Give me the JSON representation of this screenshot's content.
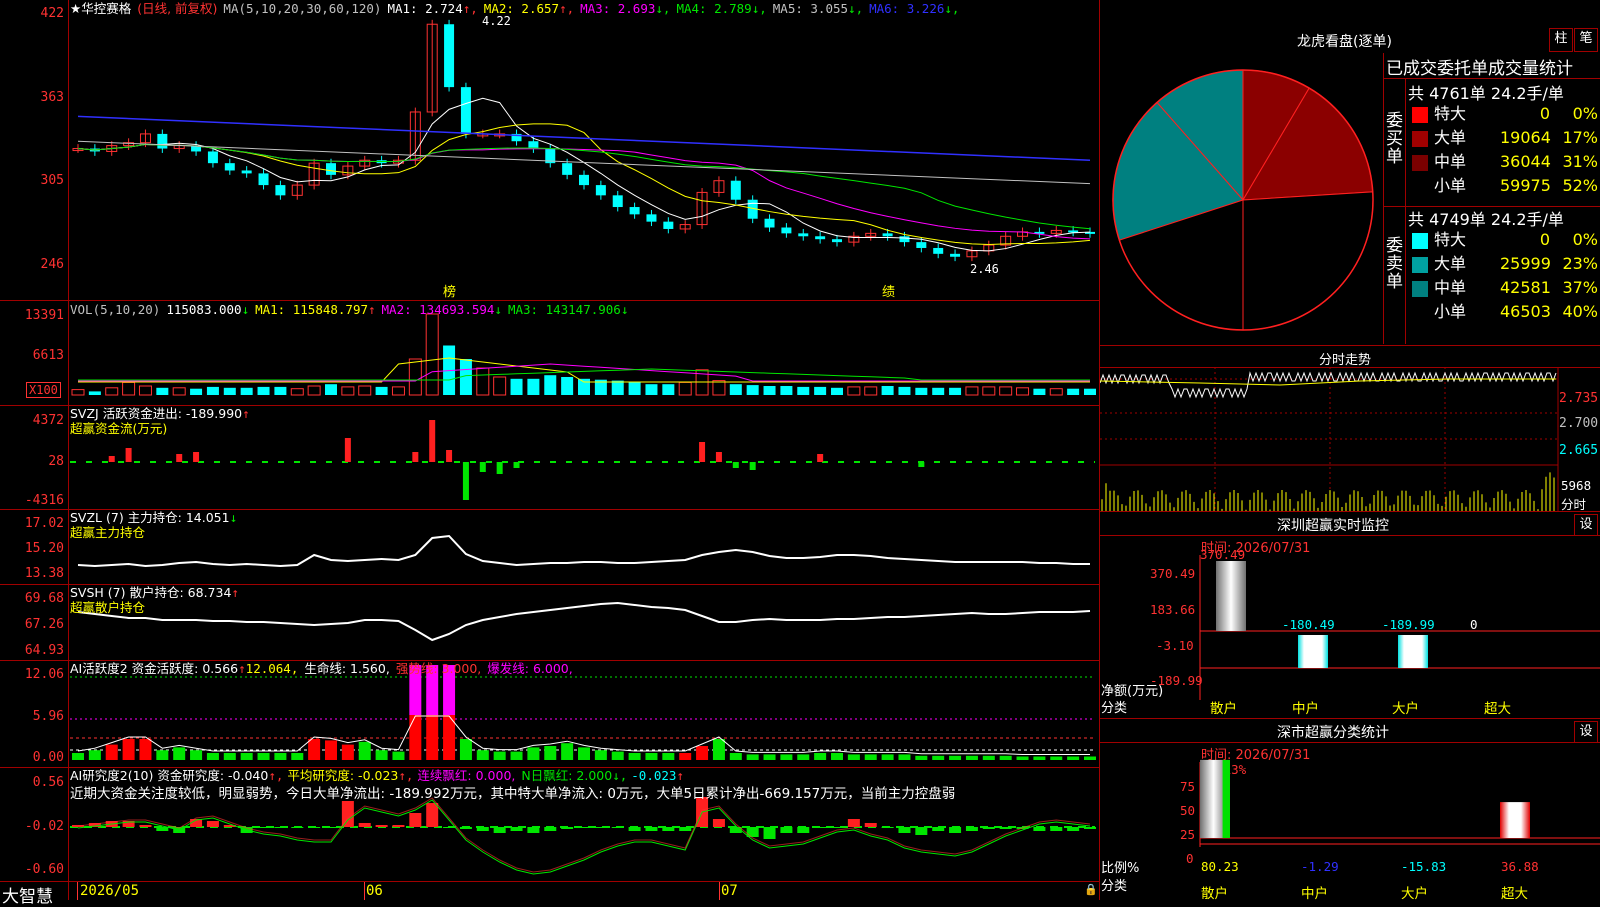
{
  "stock": {
    "name_star": "★华控赛格",
    "period": "(日线, 前复权)",
    "ma_title": "MA(5,10,20,30,60,120)",
    "ma_values": [
      {
        "label": "MA1: 2.724",
        "arrow": "↑",
        "color": "#ffffff"
      },
      {
        "label": "MA2: 2.657",
        "arrow": "↑",
        "color": "#ffff00"
      },
      {
        "label": "MA3: 2.693",
        "arrow": "↓",
        "color": "#ff00ff"
      },
      {
        "label": "MA4: 2.789",
        "arrow": "↓",
        "color": "#00e600"
      },
      {
        "label": "MA5: 3.055",
        "arrow": "↓",
        "color": "#c0c0c0"
      },
      {
        "label": "MA6: 3.226",
        "arrow": "↓",
        "color": "#3030ff"
      }
    ],
    "price_axis": [
      "422",
      "363",
      "305",
      "246"
    ],
    "high_label": "4.22",
    "low_label": "2.46",
    "mark_bang": "榜",
    "mark_ji": "绩"
  },
  "vol": {
    "title": "VOL(5,10,20)",
    "value": "115083.000",
    "arrow": "↓",
    "ma1": "MA1: 115848.797",
    "ma1_arrow": "↑",
    "ma2": "MA2: 134693.594",
    "ma2_arrow": "↓",
    "ma3": "MA3: 143147.906",
    "ma3_arrow": "↓",
    "axis": [
      "13391",
      "6613"
    ],
    "unit": "X100"
  },
  "svzj": {
    "title": "SVZJ  活跃资金进出: -189.990",
    "arrow": "↑",
    "sub": "超赢资金流(万元)",
    "axis": [
      "4372",
      "28",
      "-4316"
    ]
  },
  "svzl": {
    "title": "SVZL (7) 主力持仓: 14.051",
    "arrow": "↓",
    "sub": "超赢主力持仓",
    "axis": [
      "17.02",
      "15.20",
      "13.38"
    ]
  },
  "svsh": {
    "title": "SVSH (7) 散户持仓: 68.734",
    "arrow": "↑",
    "sub": "超赢散户持仓",
    "axis": [
      "69.68",
      "67.26",
      "64.93"
    ]
  },
  "ai_active": {
    "title": "AI活跃度2 资金活跃度: 0.566",
    "t2": "12.064,",
    "t3": "生命线: 1.560,",
    "t4": "强势线: 3.000,",
    "t5": "爆发线: 6.000,",
    "axis": [
      "12.06",
      "5.96",
      "0.00"
    ]
  },
  "ai_research": {
    "title": "AI研究度2(10) 资金研究度: -0.040",
    "t2": "平均研究度: -0.023",
    "t3": "连续飘红: 0.000,",
    "t4": "N日飘红: 2.000",
    "t5": "-0.023",
    "comment": "近期大资金关注度较低，明显弱势，今日大单净流出: -189.992万元，其中特大单净流入: 0万元，大单5日累计净出-669.157万元，当前主力控盘弱",
    "axis": [
      "0.56",
      "-0.02",
      "-0.60"
    ]
  },
  "bottom": {
    "brand": "大智慧",
    "dates": [
      "2026/05",
      "06",
      "07"
    ]
  },
  "dragon": {
    "title": "龙虎看盘(逐单)",
    "btn1": "柱",
    "btn2": "笔",
    "heading": "已成交委托单成交量统计",
    "buy_label": "委买单",
    "sell_label": "委卖单",
    "buy_total": "共 4761单 24.2手/单",
    "sell_total": "共 4749单 24.2手/单",
    "buy_rows": [
      {
        "name": "特大",
        "vol": "0",
        "pct": "0%",
        "color": "#ff0000"
      },
      {
        "name": "大单",
        "vol": "19064",
        "pct": "17%",
        "color": "#a00000"
      },
      {
        "name": "中单",
        "vol": "36044",
        "pct": "31%",
        "color": "#7a0000"
      },
      {
        "name": "小单",
        "vol": "59975",
        "pct": "52%",
        "color": "#000000"
      }
    ],
    "sell_rows": [
      {
        "name": "特大",
        "vol": "0",
        "pct": "0%",
        "color": "#00ffff"
      },
      {
        "name": "大单",
        "vol": "25999",
        "pct": "23%",
        "color": "#00a0a0"
      },
      {
        "name": "中单",
        "vol": "42581",
        "pct": "37%",
        "color": "#008080"
      },
      {
        "name": "小单",
        "vol": "46503",
        "pct": "40%",
        "color": "#000000"
      }
    ],
    "pie": {
      "buy": [
        0,
        17,
        31,
        52
      ],
      "sell": [
        0,
        23,
        37,
        40
      ]
    }
  },
  "intraday": {
    "title": "分时走势",
    "axis": [
      "2.735",
      "2.700",
      "2.665"
    ],
    "vol_label": "5968",
    "vol_unit": "分时"
  },
  "sz_monitor": {
    "title": "深圳超赢实时监控",
    "btn": "设",
    "time": "时间: 2026/07/31",
    "axis": [
      "370.49",
      "183.66",
      "-3.10",
      "-189.99"
    ],
    "ylabel": "净额(万元)",
    "xlabel": "分类",
    "bars": [
      {
        "cat": "散户",
        "value": 370.49,
        "label": "370.49"
      },
      {
        "cat": "中户",
        "value": -180.49,
        "label": "-180.49"
      },
      {
        "cat": "大户",
        "value": -189.99,
        "label": "-189.99"
      },
      {
        "cat": "超大",
        "value": 0,
        "label": "0"
      }
    ]
  },
  "sz_class": {
    "title": "深市超赢分类统计",
    "btn": "设",
    "time": "时间: 2026/07/31",
    "top": "+0.13%",
    "axis": [
      "75",
      "50",
      "25",
      "0"
    ],
    "ylabel": "比例%",
    "xlabel": "分类",
    "bars": [
      {
        "cat": "散户",
        "value": 80.23,
        "label": "80.23"
      },
      {
        "cat": "中户",
        "value": -1.29,
        "label": "-1.29"
      },
      {
        "cat": "大户",
        "value": -15.83,
        "label": "-15.83"
      },
      {
        "cat": "超大",
        "value": 36.88,
        "label": "36.88"
      }
    ]
  }
}
